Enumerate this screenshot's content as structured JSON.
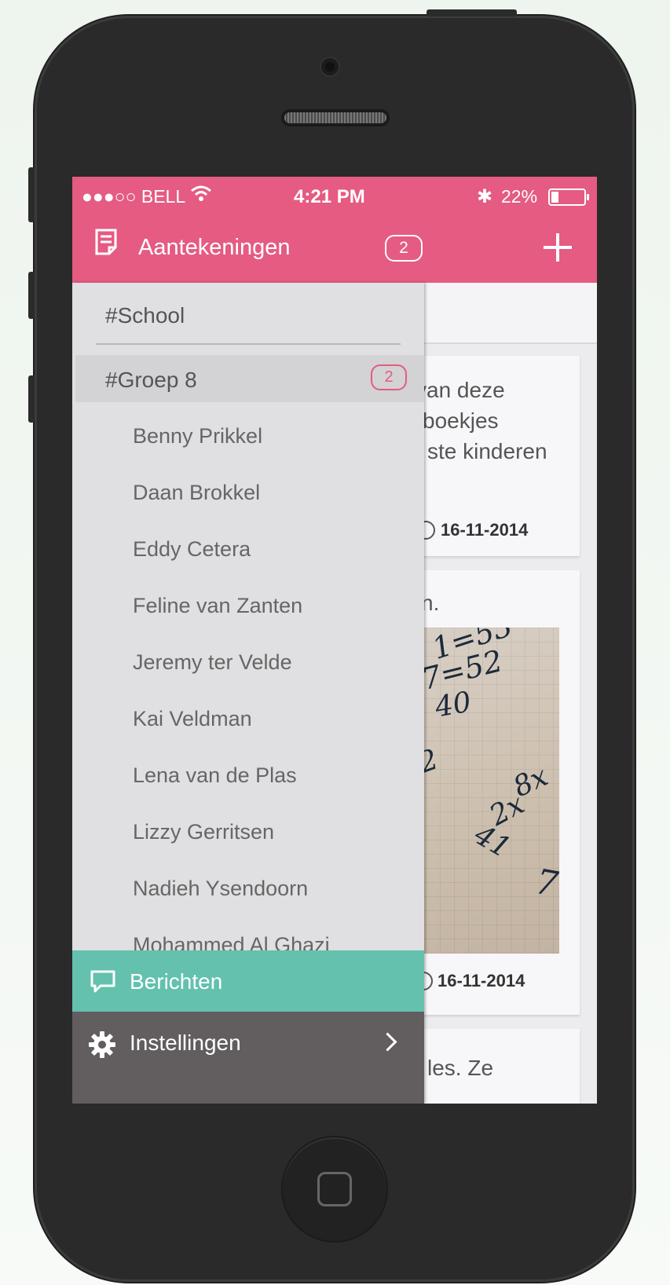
{
  "status_bar": {
    "carrier": "●●●○○ BELL",
    "time": "4:21 PM",
    "bluetooth": "✱",
    "battery_text": "22%",
    "battery_level": 0.22
  },
  "nav": {
    "title": "Aantekeningen",
    "badge": "2",
    "icons": [
      "note-icon",
      "plus-icon"
    ]
  },
  "drawer": {
    "school_tag": "#School",
    "group": {
      "label": "#Groep 8",
      "badge": "2"
    },
    "students": [
      "Benny Prikkel",
      "Daan Brokkel",
      "Eddy Cetera",
      "Feline van Zanten",
      "Jeremy ter Velde",
      "Kai Veldman",
      "Lena van de Plas",
      "Lizzy Gerritsen",
      "Nadieh Ysendoorn",
      "Mohammed Al Ghazi"
    ],
    "messages_label": "Berichten",
    "settings_label": "Instellingen"
  },
  "content": {
    "card1": {
      "lines": [
        "van deze",
        "boekjes",
        "ste kinderen"
      ],
      "date": "16-11-2014"
    },
    "card2": {
      "text": "n.",
      "date": "16-11-2014",
      "photo_writing": [
        "1=53",
        "7=52",
        "40",
        "2",
        "8x",
        "2x",
        "41",
        "7"
      ]
    },
    "card3": {
      "text": "les. Ze"
    }
  },
  "colors": {
    "header_pink": "#e55b82",
    "messages_teal": "#63c1ad",
    "settings_gray": "#625d5f",
    "drawer_bg": "#e0dfe1"
  }
}
